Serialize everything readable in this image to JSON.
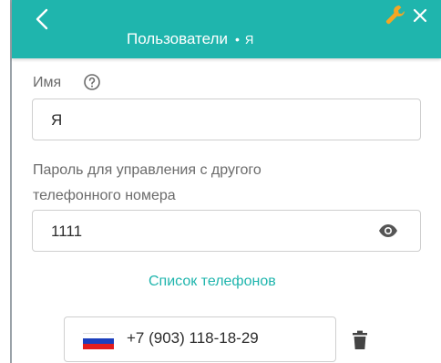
{
  "header": {
    "title": "Пользователи",
    "separator": "•",
    "subtitle": "Я",
    "back_icon": "chevron-left-icon",
    "settings_icon": "wrench-icon",
    "close_icon": "close-icon"
  },
  "form": {
    "name_label": "Имя",
    "name_value": "Я",
    "password_label_line1": "Пароль для управления с другого",
    "password_label_line2": "телефонного номера",
    "password_value": "1111"
  },
  "phones": {
    "title": "Список телефонов",
    "items": [
      {
        "country_flag": "russia-flag-icon",
        "number": "+7 (903) 118-18-29"
      }
    ]
  },
  "colors": {
    "accent": "#1fb5ad",
    "wrench": "#f5a623"
  }
}
